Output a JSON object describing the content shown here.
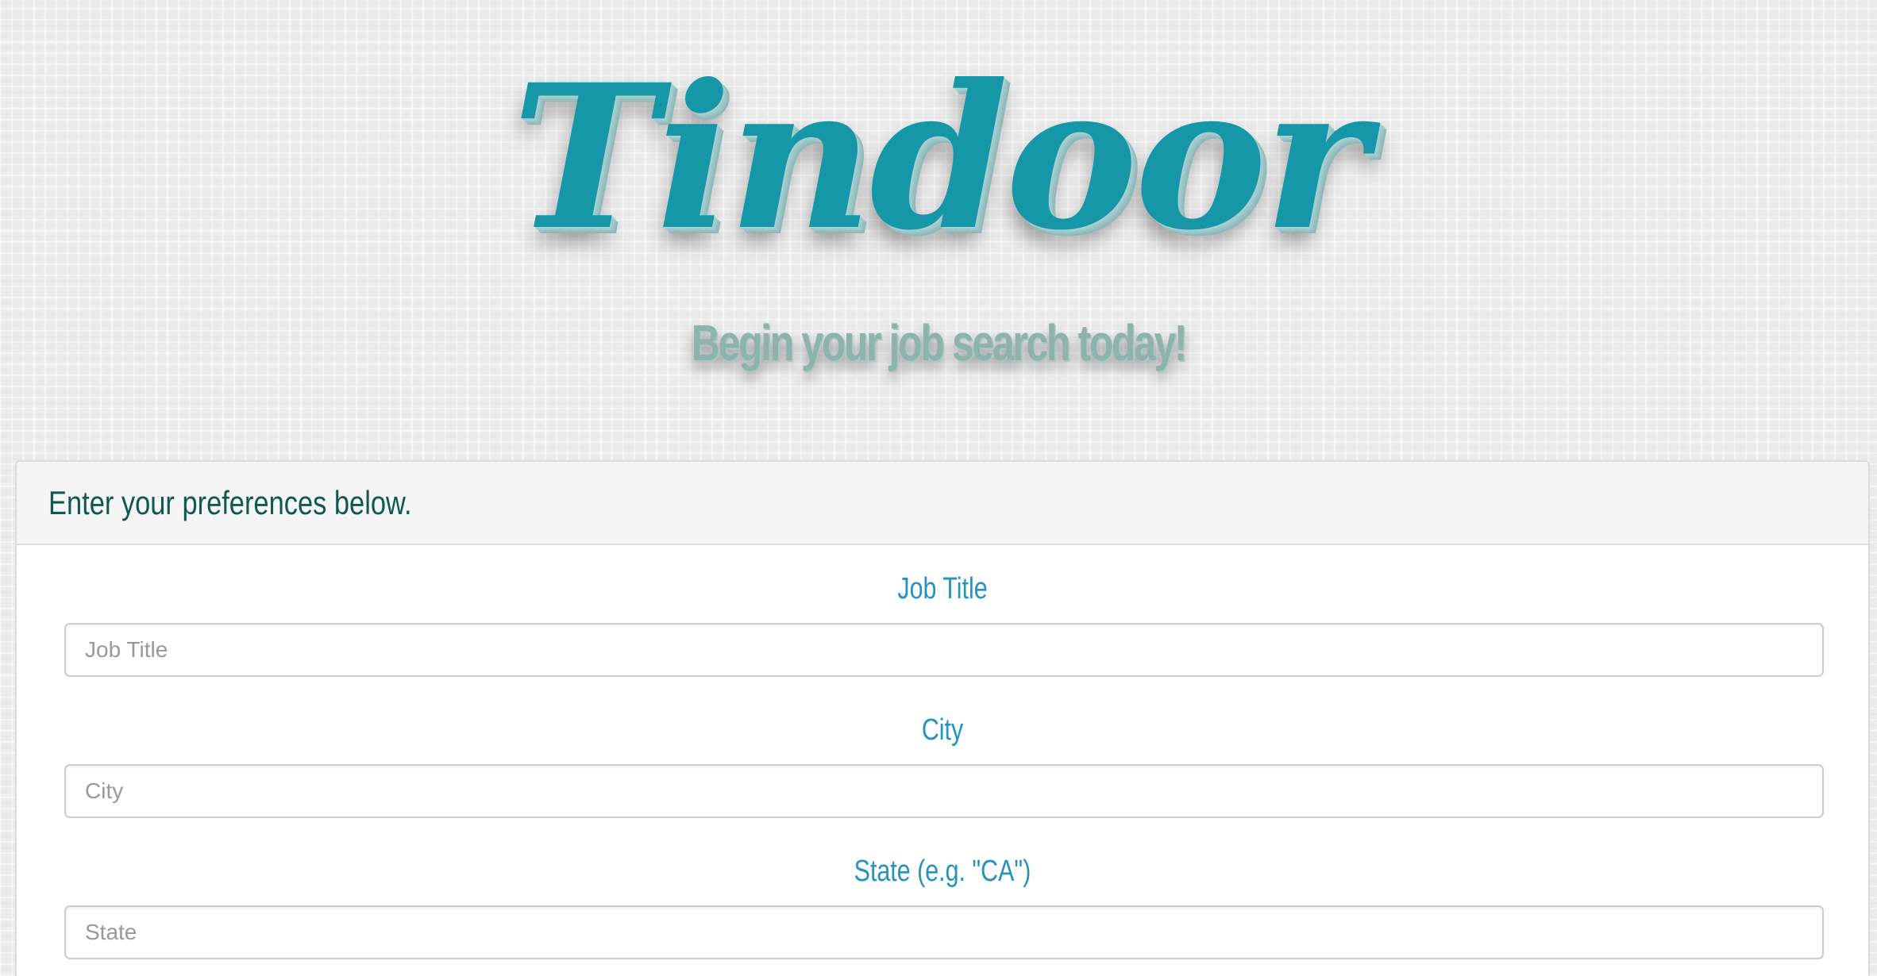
{
  "header": {
    "logo_text": "Tindoor",
    "tagline": "Begin your job search today!"
  },
  "panel": {
    "title": "Enter your preferences below."
  },
  "form": {
    "fields": [
      {
        "label": "Job Title",
        "placeholder": "Job Title",
        "value": ""
      },
      {
        "label": "City",
        "placeholder": "City",
        "value": ""
      },
      {
        "label": "State (e.g. \"CA\")",
        "placeholder": "State",
        "value": ""
      }
    ]
  },
  "colors": {
    "logo": "#1597a8",
    "tagline": "#8eb3ab",
    "panel_title": "#0f5a4c",
    "field_label": "#2593bc",
    "background": "#ebebeb"
  }
}
